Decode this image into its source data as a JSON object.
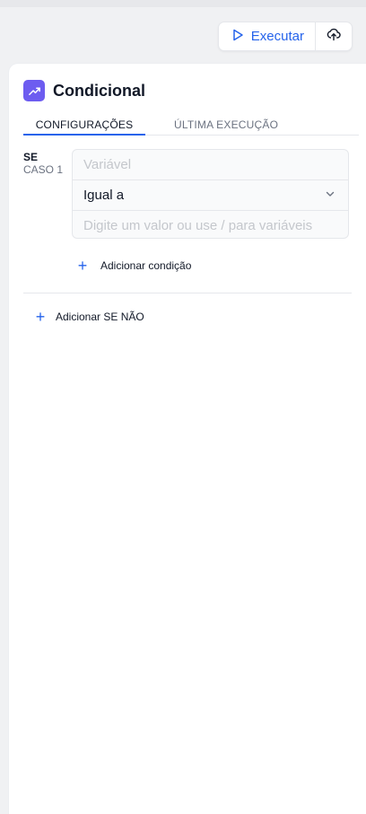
{
  "toolbar": {
    "run_label": "Executar",
    "accent": "#2563eb",
    "run_icon": "play-icon",
    "upload_icon": "cloud-upload-icon"
  },
  "node": {
    "title": "Condicional",
    "icon": "trending-up-icon",
    "icon_bg": "#6d5cf0"
  },
  "tabs": [
    {
      "label": "CONFIGURAÇÕES",
      "active": true
    },
    {
      "label": "ÚLTIMA EXECUÇÃO",
      "active": false
    }
  ],
  "case": {
    "keyword": "SE",
    "name": "CASO 1",
    "variable_placeholder": "Variável",
    "operator": "Igual a",
    "value_placeholder": "Digite um valor ou use / para variáveis"
  },
  "actions": {
    "add_condition": "Adicionar condição",
    "add_else": "Adicionar SE NÃO"
  }
}
